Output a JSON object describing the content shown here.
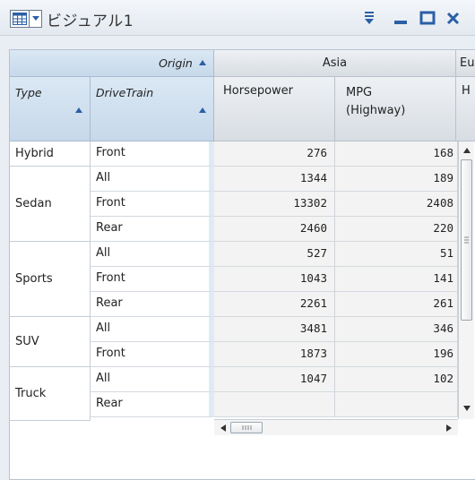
{
  "window": {
    "title": "ビジュアル1"
  },
  "header": {
    "origin_label": "Origin",
    "group_asia": "Asia",
    "group_next": "Eu",
    "type_label": "Type",
    "drivetrain_label": "DriveTrain",
    "col_horsepower": "Horsepower",
    "col_mpg_line1": "MPG",
    "col_mpg_line2": "(Highway)",
    "col_next": "H"
  },
  "rows": [
    {
      "type": "Hybrid",
      "drive": "Front",
      "horsepower": "276",
      "mpg": "168"
    },
    {
      "type": "Sedan",
      "drive": "All",
      "horsepower": "1344",
      "mpg": "189"
    },
    {
      "type": "",
      "drive": "Front",
      "horsepower": "13302",
      "mpg": "2408"
    },
    {
      "type": "",
      "drive": "Rear",
      "horsepower": "2460",
      "mpg": "220"
    },
    {
      "type": "Sports",
      "drive": "All",
      "horsepower": "527",
      "mpg": "51"
    },
    {
      "type": "",
      "drive": "Front",
      "horsepower": "1043",
      "mpg": "141"
    },
    {
      "type": "",
      "drive": "Rear",
      "horsepower": "2261",
      "mpg": "261"
    },
    {
      "type": "SUV",
      "drive": "All",
      "horsepower": "3481",
      "mpg": "346"
    },
    {
      "type": "",
      "drive": "Front",
      "horsepower": "1873",
      "mpg": "196"
    },
    {
      "type": "Truck",
      "drive": "All",
      "horsepower": "1047",
      "mpg": "102"
    },
    {
      "type": "",
      "drive": "Rear",
      "horsepower": "",
      "mpg": ""
    }
  ],
  "groups": [
    {
      "label": "Hybrid"
    },
    {
      "label": "Sedan"
    },
    {
      "label": "Sports"
    },
    {
      "label": "SUV"
    },
    {
      "label": "Truck"
    }
  ],
  "icons": {
    "grid": "table-grid-icon",
    "dropdown": "chevron-down-icon",
    "filter": "filter-icon",
    "minimize": "minimize-icon",
    "maximize": "maximize-icon",
    "close": "close-icon"
  },
  "colors": {
    "accent": "#2b5fa6",
    "header_blue": "#c6d8ea",
    "value_bg": "#f3f3f3"
  }
}
